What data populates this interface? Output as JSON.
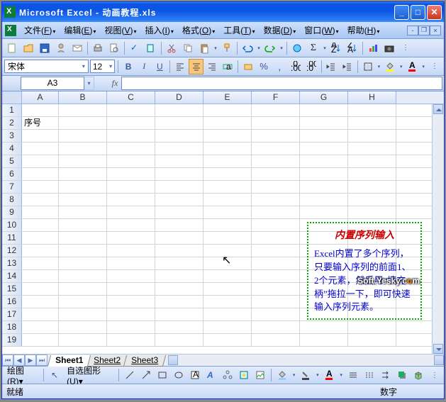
{
  "title": "Microsoft Excel - 动画教程.xls",
  "menu": {
    "file": "文件",
    "file_k": "F",
    "edit": "编辑",
    "edit_k": "E",
    "view": "视图",
    "view_k": "V",
    "insert": "插入",
    "insert_k": "I",
    "format": "格式",
    "format_k": "O",
    "tools": "工具",
    "tools_k": "T",
    "data": "数据",
    "data_k": "D",
    "window": "窗口",
    "window_k": "W",
    "help": "帮助",
    "help_k": "H"
  },
  "format": {
    "font_name": "宋体",
    "font_size": "12"
  },
  "namebox": "A3",
  "columns": [
    "A",
    "B",
    "C",
    "D",
    "E",
    "F",
    "G",
    "H"
  ],
  "rows": [
    "1",
    "2",
    "3",
    "4",
    "5",
    "6",
    "7",
    "8",
    "9",
    "10",
    "11",
    "12",
    "13",
    "14",
    "15",
    "16",
    "17",
    "18",
    "19"
  ],
  "cells": {
    "A2": "序号"
  },
  "sheets": {
    "s1": "Sheet1",
    "s2": "Sheet2",
    "s3": "Sheet3"
  },
  "draw": {
    "label": "绘图",
    "key": "R",
    "autoshapes": "自选图形",
    "autoshapes_k": "U"
  },
  "status": {
    "ready": "就绪",
    "num": "数字"
  },
  "tooltip": {
    "title": "内置序列输入",
    "body": "Excel内置了多个序列，只要输入序列的前面1、2个元素，然后用“填充柄”拖拉一下，即可快速输入序列元素。"
  },
  "watermark": {
    "a": "Soft.Yesky.c",
    "b": "o",
    "c": "m"
  }
}
